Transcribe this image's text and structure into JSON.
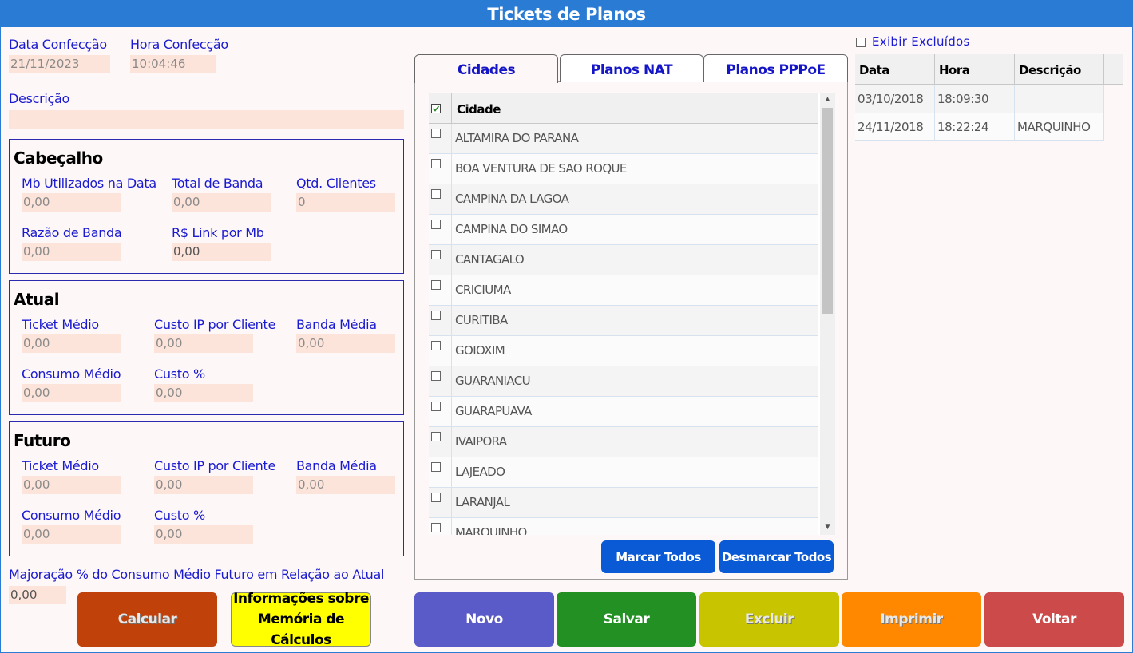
{
  "window": {
    "title": "Tickets de Planos"
  },
  "header": {
    "data_label": "Data Confecção",
    "data_value": "21/11/2023",
    "hora_label": "Hora Confecção",
    "hora_value": "10:04:46",
    "descricao_label": "Descrição",
    "descricao_value": ""
  },
  "cabecalho": {
    "title": "Cabeçalho",
    "mb_label": "Mb Utilizados na Data",
    "mb_value": "0,00",
    "total_label": "Total de Banda",
    "total_value": "0,00",
    "qtd_label": "Qtd. Clientes",
    "qtd_value": "0",
    "razao_label": "Razão de Banda",
    "razao_value": "0,00",
    "link_label": "R$ Link por Mb",
    "link_value": "0,00"
  },
  "atual": {
    "title": "Atual",
    "ticket_label": "Ticket Médio",
    "ticket_value": "0,00",
    "custoip_label": "Custo IP por Cliente",
    "custoip_value": "0,00",
    "banda_label": "Banda Média",
    "banda_value": "0,00",
    "consumo_label": "Consumo Médio",
    "consumo_value": "0,00",
    "custo_label": "Custo %",
    "custo_value": "0,00"
  },
  "futuro": {
    "title": "Futuro",
    "ticket_label": "Ticket Médio",
    "ticket_value": "0,00",
    "custoip_label": "Custo IP por Cliente",
    "custoip_value": "0,00",
    "banda_label": "Banda Média",
    "banda_value": "0,00",
    "consumo_label": "Consumo Médio",
    "consumo_value": "0,00",
    "custo_label": "Custo %",
    "custo_value": "0,00"
  },
  "majoracao": {
    "label": "Majoração % do Consumo Médio Futuro em Relação ao Atual",
    "value": "0,00"
  },
  "buttons": {
    "calcular": "Calcular",
    "info_line1": "Informações sobre",
    "info_line2": "Memória de Cálculos",
    "novo": "Novo",
    "salvar": "Salvar",
    "excluir": "Excluir",
    "imprimir": "Imprimir",
    "voltar": "Voltar",
    "marcar": "Marcar Todos",
    "desmarcar": "Desmarcar Todos"
  },
  "tabs": [
    {
      "label": "Cidades"
    },
    {
      "label": "Planos NAT"
    },
    {
      "label": "Planos PPPoE"
    }
  ],
  "cidades": {
    "header": "Cidade",
    "rows": [
      "ALTAMIRA DO PARANA",
      "BOA VENTURA DE SAO ROQUE",
      "CAMPINA DA LAGOA",
      "CAMPINA DO SIMAO",
      "CANTAGALO",
      "CRICIUMA",
      "CURITIBA",
      "GOIOXIM",
      "GUARANIACU",
      "GUARAPUAVA",
      "IVAIPORA",
      "LAJEADO",
      "LARANJAL",
      "MARQUINHO"
    ]
  },
  "historico": {
    "exibir_label": "Exibir Excluídos",
    "headers": [
      "Data",
      "Hora",
      "Descrição"
    ],
    "rows": [
      [
        "03/10/2018",
        "18:09:30",
        ""
      ],
      [
        "24/11/2018",
        "18:22:24",
        "MARQUINHO"
      ]
    ]
  },
  "colors": {
    "title_bar": "#2a7bd3",
    "calcular": "#c0410a",
    "info": "#ffff00",
    "novo": "#5a5ac8",
    "salvar": "#229022",
    "excluir": "#c8c400",
    "imprimir": "#ff8800",
    "voltar": "#cc4a4a",
    "blue_btn": "#0a5ad6"
  }
}
